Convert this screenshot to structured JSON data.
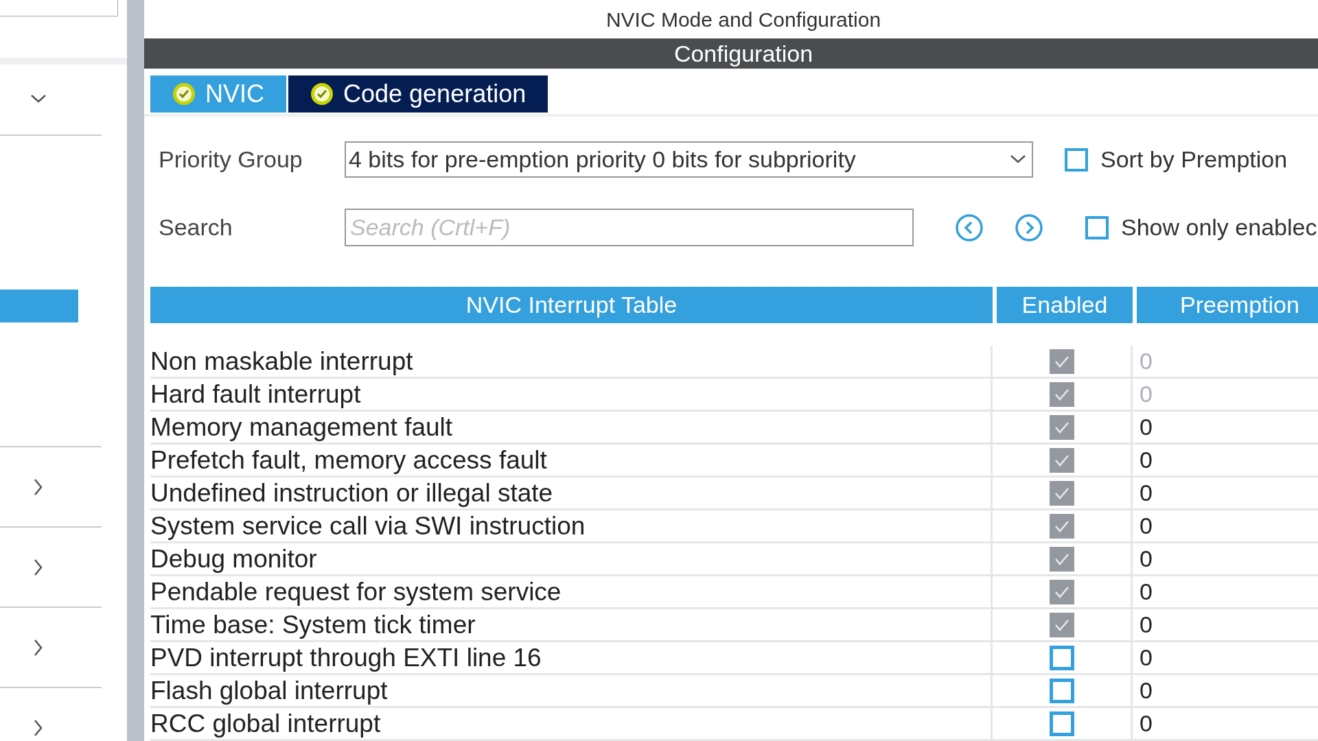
{
  "panel_title": "NVIC Mode and Configuration",
  "section_title": "Configuration",
  "tabs": [
    {
      "label": "NVIC",
      "selected": true
    },
    {
      "label": "Code generation",
      "selected": false
    }
  ],
  "priority_group": {
    "label": "Priority Group",
    "value": "4 bits for pre-emption priority 0 bits for subpriority"
  },
  "sort_by_preemption": {
    "label": "Sort by Premption",
    "checked": false
  },
  "search": {
    "label": "Search",
    "placeholder": "Search (Crtl+F)"
  },
  "show_only_enabled": {
    "label": "Show only enablec",
    "checked": false
  },
  "table": {
    "columns": [
      "NVIC Interrupt Table",
      "Enabled",
      "Preemption"
    ],
    "rows": [
      {
        "name": "Non maskable interrupt",
        "enabled": true,
        "locked": true,
        "preemption": "0",
        "preemption_disabled": true
      },
      {
        "name": "Hard fault interrupt",
        "enabled": true,
        "locked": true,
        "preemption": "0",
        "preemption_disabled": true
      },
      {
        "name": "Memory management fault",
        "enabled": true,
        "locked": true,
        "preemption": "0",
        "preemption_disabled": false
      },
      {
        "name": "Prefetch fault, memory access fault",
        "enabled": true,
        "locked": true,
        "preemption": "0",
        "preemption_disabled": false
      },
      {
        "name": "Undefined instruction or illegal state",
        "enabled": true,
        "locked": true,
        "preemption": "0",
        "preemption_disabled": false
      },
      {
        "name": "System service call via SWI instruction",
        "enabled": true,
        "locked": true,
        "preemption": "0",
        "preemption_disabled": false
      },
      {
        "name": "Debug monitor",
        "enabled": true,
        "locked": true,
        "preemption": "0",
        "preemption_disabled": false
      },
      {
        "name": "Pendable request for system service",
        "enabled": true,
        "locked": true,
        "preemption": "0",
        "preemption_disabled": false
      },
      {
        "name": "Time base: System tick timer",
        "enabled": true,
        "locked": true,
        "preemption": "0",
        "preemption_disabled": false
      },
      {
        "name": "PVD interrupt through EXTI line 16",
        "enabled": false,
        "locked": false,
        "preemption": "0",
        "preemption_disabled": false
      },
      {
        "name": "Flash global interrupt",
        "enabled": false,
        "locked": false,
        "preemption": "0",
        "preemption_disabled": false
      },
      {
        "name": "RCC global interrupt",
        "enabled": false,
        "locked": false,
        "preemption": "0",
        "preemption_disabled": false
      }
    ]
  },
  "sidebar": {
    "items": [
      {
        "kind": "dropdown"
      },
      {
        "kind": "selected"
      },
      {
        "kind": "collapsed"
      },
      {
        "kind": "collapsed"
      },
      {
        "kind": "collapsed"
      },
      {
        "kind": "collapsed"
      }
    ]
  }
}
